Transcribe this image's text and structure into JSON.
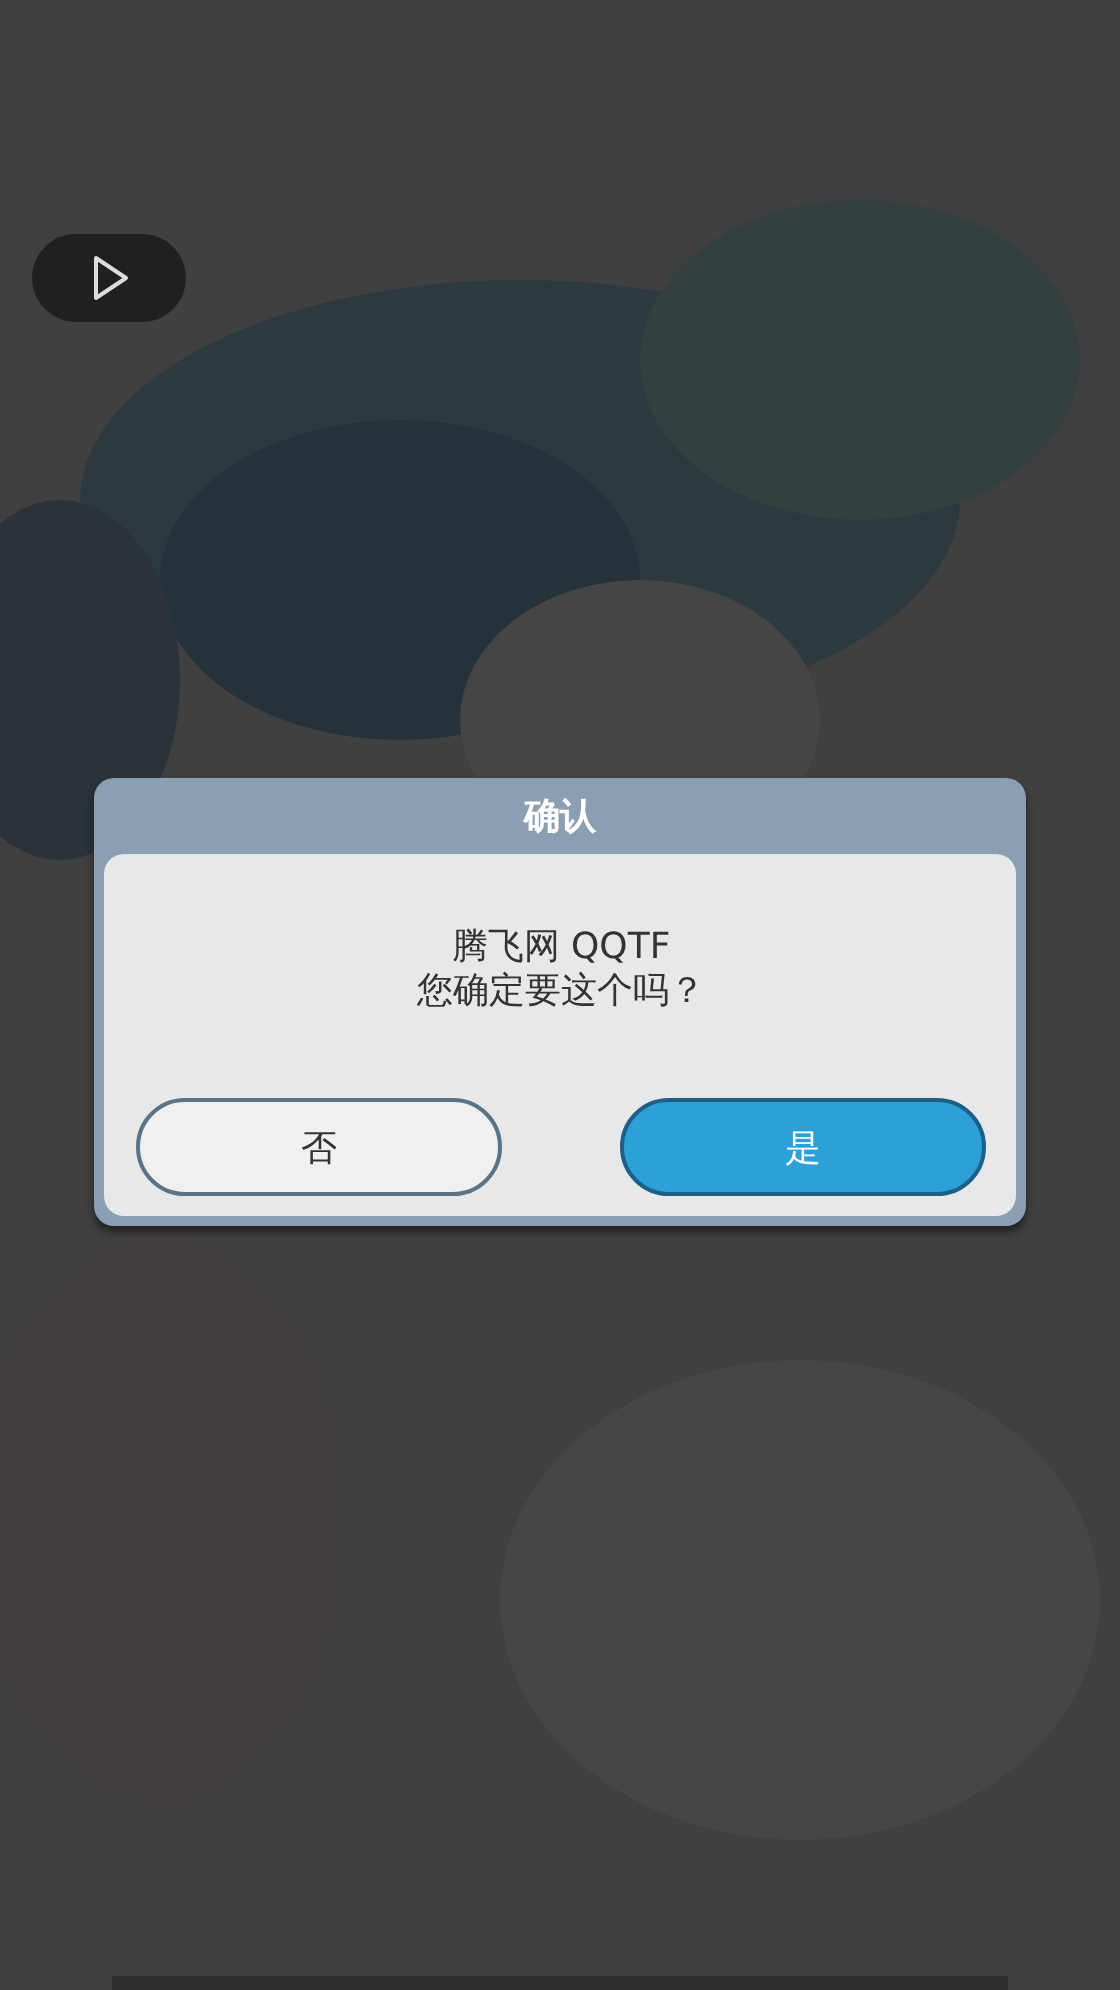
{
  "dialog": {
    "title": "确认",
    "message_lines": [
      "腾飞网 QQTF",
      "您确定要这个吗？"
    ],
    "buttons": [
      {
        "label": "否",
        "kind": "secondary"
      },
      {
        "label": "是",
        "kind": "primary"
      }
    ]
  }
}
